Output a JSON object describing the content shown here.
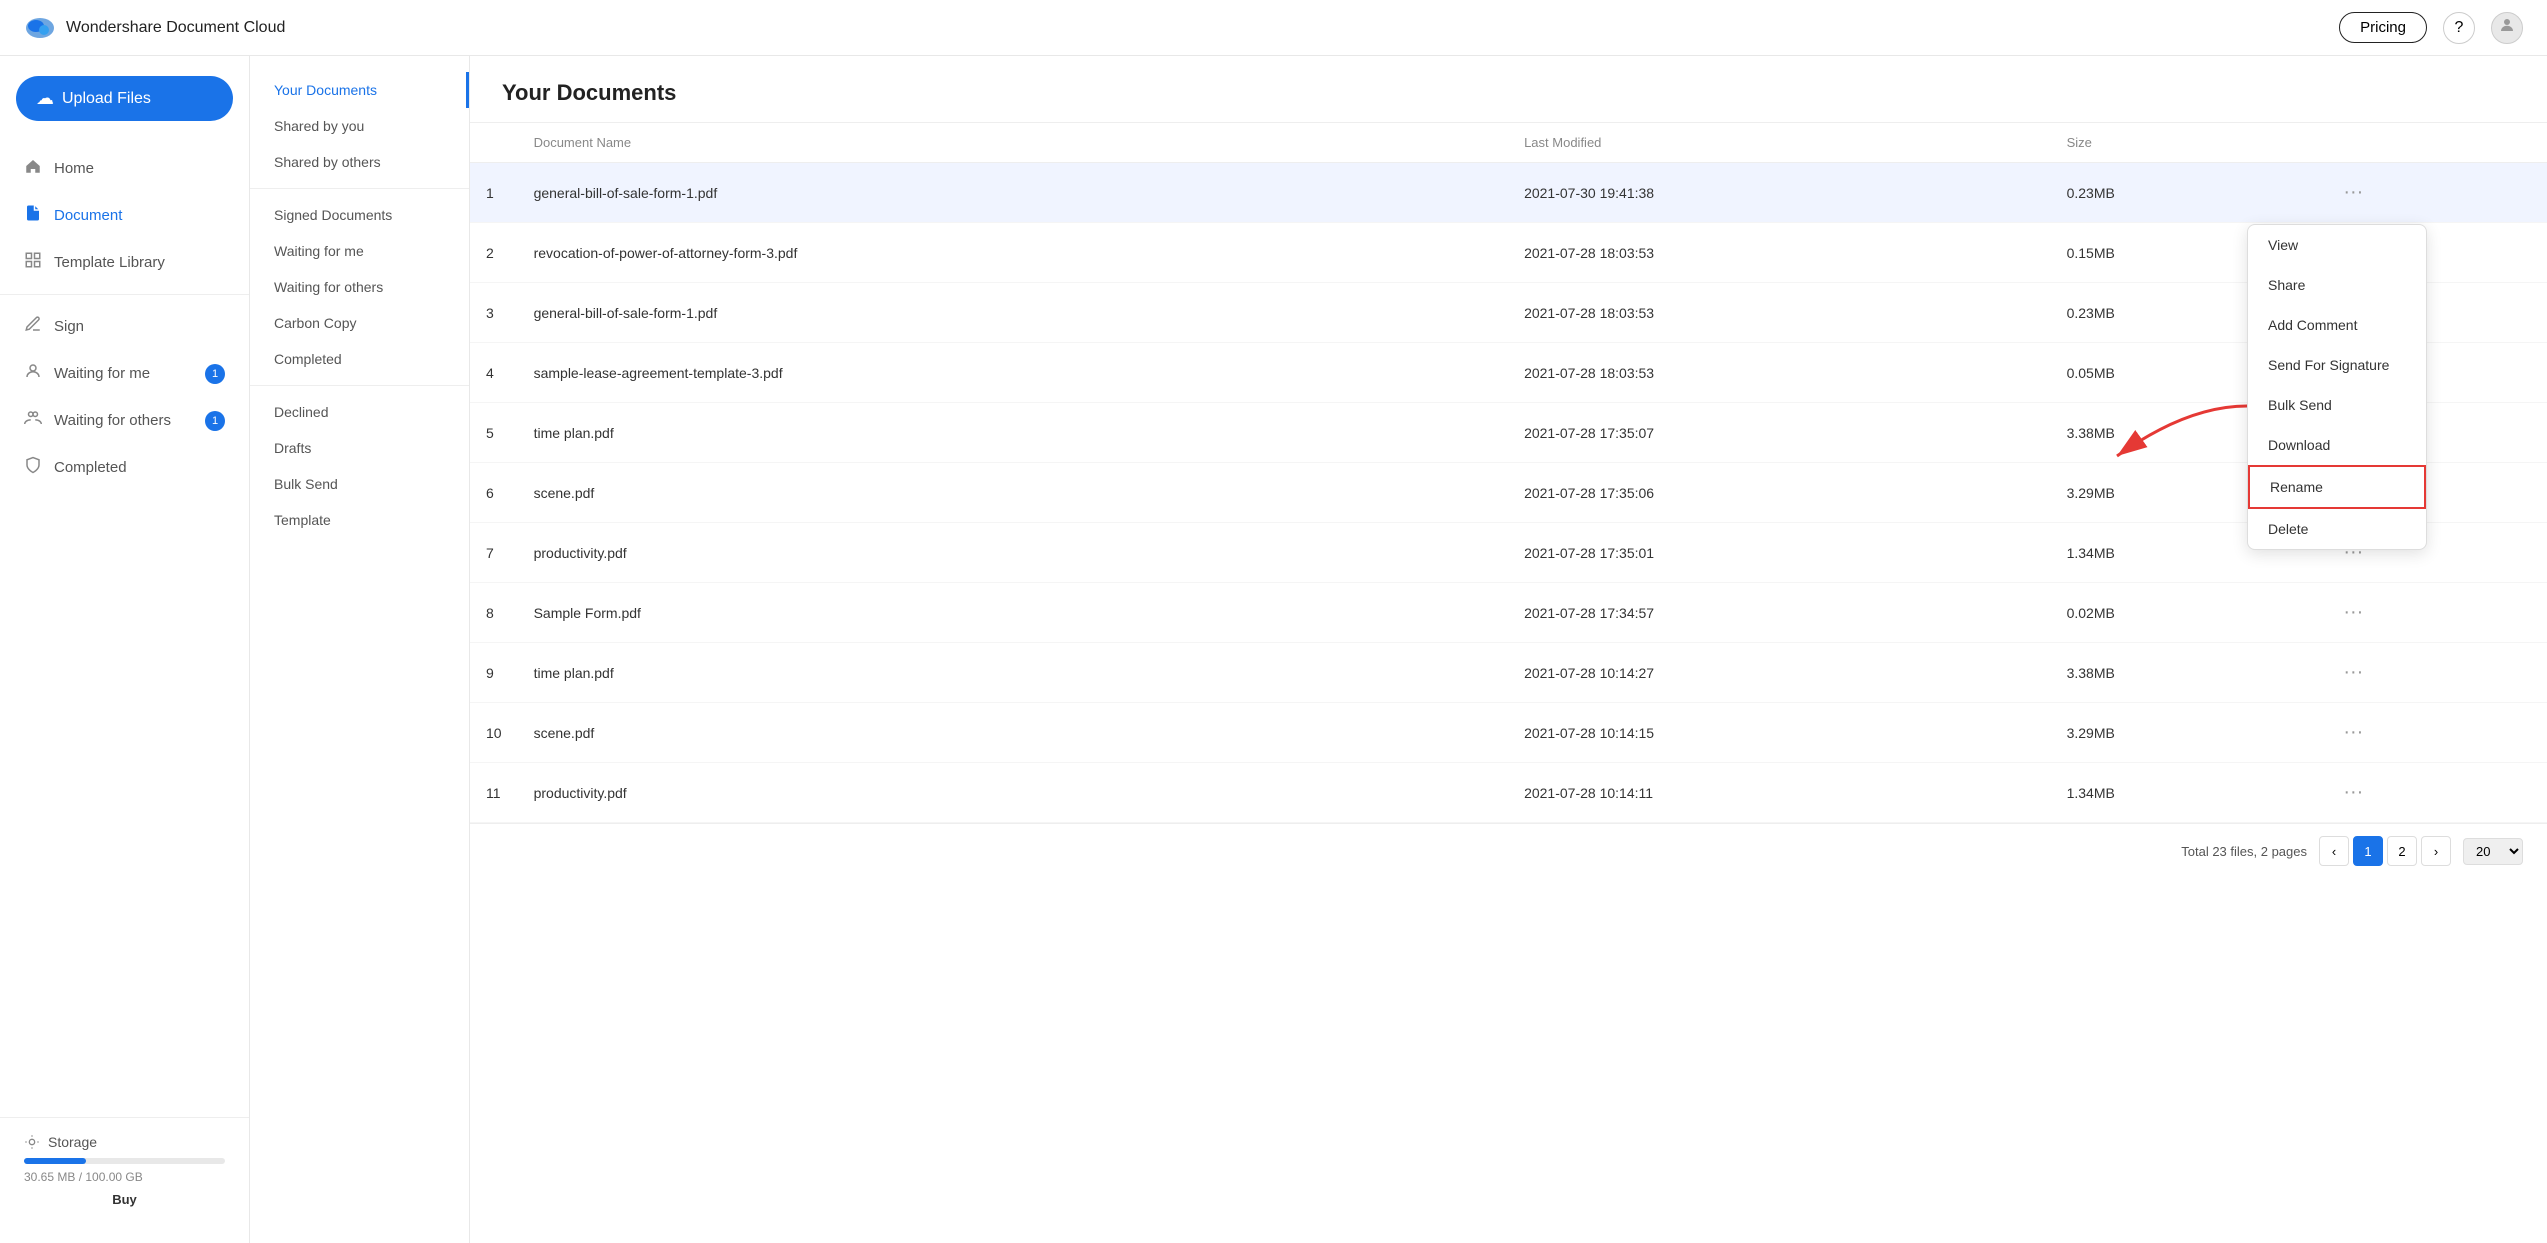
{
  "app": {
    "name": "Wondershare Document Cloud",
    "logo_color": "#1a73e8"
  },
  "nav": {
    "pricing_label": "Pricing",
    "help_icon": "?",
    "avatar_icon": "👤"
  },
  "sidebar": {
    "upload_label": "Upload Files",
    "items": [
      {
        "id": "home",
        "label": "Home",
        "icon": "🏠",
        "active": false
      },
      {
        "id": "document",
        "label": "Document",
        "icon": "📄",
        "active": true
      },
      {
        "id": "template-library",
        "label": "Template Library",
        "icon": "📋",
        "active": false
      }
    ],
    "sign_section": [
      {
        "id": "sign",
        "label": "Sign",
        "icon": "✍️",
        "active": false
      },
      {
        "id": "waiting-for-me",
        "label": "Waiting for me",
        "icon": "👤",
        "badge": "1",
        "active": false
      },
      {
        "id": "waiting-for-others",
        "label": "Waiting for others",
        "icon": "👥",
        "badge": "1",
        "active": false
      },
      {
        "id": "completed",
        "label": "Completed",
        "icon": "🛡️",
        "active": false
      }
    ],
    "storage": {
      "label": "Storage",
      "used": "30.65 MB / 100.00 GB",
      "fill_percent": 30.65,
      "buy_label": "Buy"
    }
  },
  "mid_sidebar": {
    "items": [
      {
        "id": "your-documents",
        "label": "Your Documents",
        "active": true
      },
      {
        "id": "shared-by-you",
        "label": "Shared by you",
        "active": false
      },
      {
        "id": "shared-by-others",
        "label": "Shared by others",
        "active": false
      },
      {
        "id": "signed-documents",
        "label": "Signed Documents",
        "active": false
      },
      {
        "id": "waiting-for-me",
        "label": "Waiting for me",
        "active": false
      },
      {
        "id": "waiting-for-others",
        "label": "Waiting for others",
        "active": false
      },
      {
        "id": "carbon-copy",
        "label": "Carbon Copy",
        "active": false
      },
      {
        "id": "completed",
        "label": "Completed",
        "active": false
      },
      {
        "id": "declined",
        "label": "Declined",
        "active": false
      },
      {
        "id": "drafts",
        "label": "Drafts",
        "active": false
      },
      {
        "id": "bulk-send",
        "label": "Bulk Send",
        "active": false
      },
      {
        "id": "template",
        "label": "Template",
        "active": false
      }
    ]
  },
  "content": {
    "title": "Your Documents",
    "table": {
      "columns": [
        "Document Name",
        "Last Modified",
        "Size"
      ],
      "rows": [
        {
          "num": "1",
          "name": "general-bill-of-sale-form-1.pdf",
          "modified": "2021-07-30 19:41:38",
          "size": "0.23MB",
          "highlighted": true
        },
        {
          "num": "2",
          "name": "revocation-of-power-of-attorney-form-3.pdf",
          "modified": "2021-07-28 18:03:53",
          "size": "0.15MB",
          "highlighted": false
        },
        {
          "num": "3",
          "name": "general-bill-of-sale-form-1.pdf",
          "modified": "2021-07-28 18:03:53",
          "size": "0.23MB",
          "highlighted": false
        },
        {
          "num": "4",
          "name": "sample-lease-agreement-template-3.pdf",
          "modified": "2021-07-28 18:03:53",
          "size": "0.05MB",
          "highlighted": false
        },
        {
          "num": "5",
          "name": "time plan.pdf",
          "modified": "2021-07-28 17:35:07",
          "size": "3.38MB",
          "highlighted": false
        },
        {
          "num": "6",
          "name": "scene.pdf",
          "modified": "2021-07-28 17:35:06",
          "size": "3.29MB",
          "highlighted": false
        },
        {
          "num": "7",
          "name": "productivity.pdf",
          "modified": "2021-07-28 17:35:01",
          "size": "1.34MB",
          "highlighted": false
        },
        {
          "num": "8",
          "name": "Sample Form.pdf",
          "modified": "2021-07-28 17:34:57",
          "size": "0.02MB",
          "highlighted": false
        },
        {
          "num": "9",
          "name": "time plan.pdf",
          "modified": "2021-07-28 10:14:27",
          "size": "3.38MB",
          "highlighted": false
        },
        {
          "num": "10",
          "name": "scene.pdf",
          "modified": "2021-07-28 10:14:15",
          "size": "3.29MB",
          "highlighted": false
        },
        {
          "num": "11",
          "name": "productivity.pdf",
          "modified": "2021-07-28 10:14:11",
          "size": "1.34MB",
          "highlighted": false
        }
      ]
    },
    "footer": {
      "total_text": "Total 23 files, 2 pages",
      "current_page": "1",
      "page2": "2",
      "per_page": "20"
    }
  },
  "context_menu": {
    "items": [
      {
        "id": "view",
        "label": "View",
        "highlighted": false
      },
      {
        "id": "share",
        "label": "Share",
        "highlighted": false
      },
      {
        "id": "add-comment",
        "label": "Add Comment",
        "highlighted": false
      },
      {
        "id": "send-for-signature",
        "label": "Send For Signature",
        "highlighted": false
      },
      {
        "id": "bulk-send",
        "label": "Bulk Send",
        "highlighted": false
      },
      {
        "id": "download",
        "label": "Download",
        "highlighted": false
      },
      {
        "id": "rename",
        "label": "Rename",
        "highlighted": true
      },
      {
        "id": "delete",
        "label": "Delete",
        "highlighted": false
      }
    ]
  }
}
